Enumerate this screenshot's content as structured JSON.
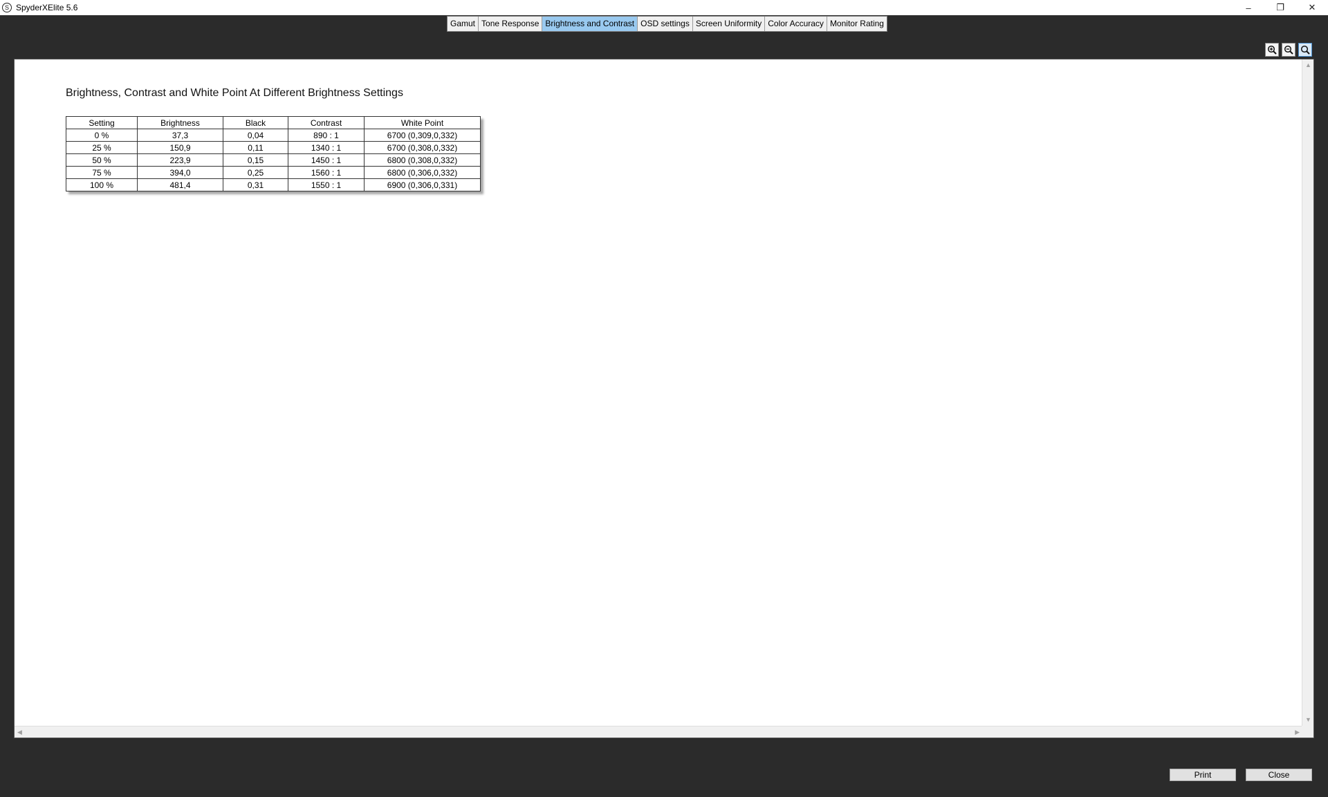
{
  "window": {
    "title": "SpyderXElite 5.6",
    "icon_glyph": "S",
    "controls": {
      "minimize": "–",
      "restore": "❐",
      "close": "✕"
    }
  },
  "tabs": [
    {
      "label": "Gamut",
      "active": false
    },
    {
      "label": "Tone Response",
      "active": false
    },
    {
      "label": "Brightness and Contrast",
      "active": true
    },
    {
      "label": "OSD settings",
      "active": false
    },
    {
      "label": "Screen Uniformity",
      "active": false
    },
    {
      "label": "Color Accuracy",
      "active": false
    },
    {
      "label": "Monitor Rating",
      "active": false
    }
  ],
  "zoom_tools": [
    {
      "icon": "zoom-in-icon",
      "active": false
    },
    {
      "icon": "zoom-out-icon",
      "active": false
    },
    {
      "icon": "zoom-fit-icon",
      "active": true
    }
  ],
  "report": {
    "heading": "Brightness, Contrast and White Point At Different Brightness Settings",
    "columns": [
      "Setting",
      "Brightness",
      "Black",
      "Contrast",
      "White Point"
    ],
    "rows": [
      [
        "0 %",
        "37,3",
        "0,04",
        "890 : 1",
        "6700 (0,309,0,332)"
      ],
      [
        "25 %",
        "150,9",
        "0,11",
        "1340 : 1",
        "6700 (0,308,0,332)"
      ],
      [
        "50 %",
        "223,9",
        "0,15",
        "1450 : 1",
        "6800 (0,308,0,332)"
      ],
      [
        "75 %",
        "394,0",
        "0,25",
        "1560 : 1",
        "6800 (0,306,0,332)"
      ],
      [
        "100 %",
        "481,4",
        "0,31",
        "1550 : 1",
        "6900 (0,306,0,331)"
      ]
    ]
  },
  "buttons": {
    "print": "Print",
    "close": "Close"
  },
  "colors": {
    "background": "#2b2b2b",
    "active_tab": "#99c9ef"
  }
}
